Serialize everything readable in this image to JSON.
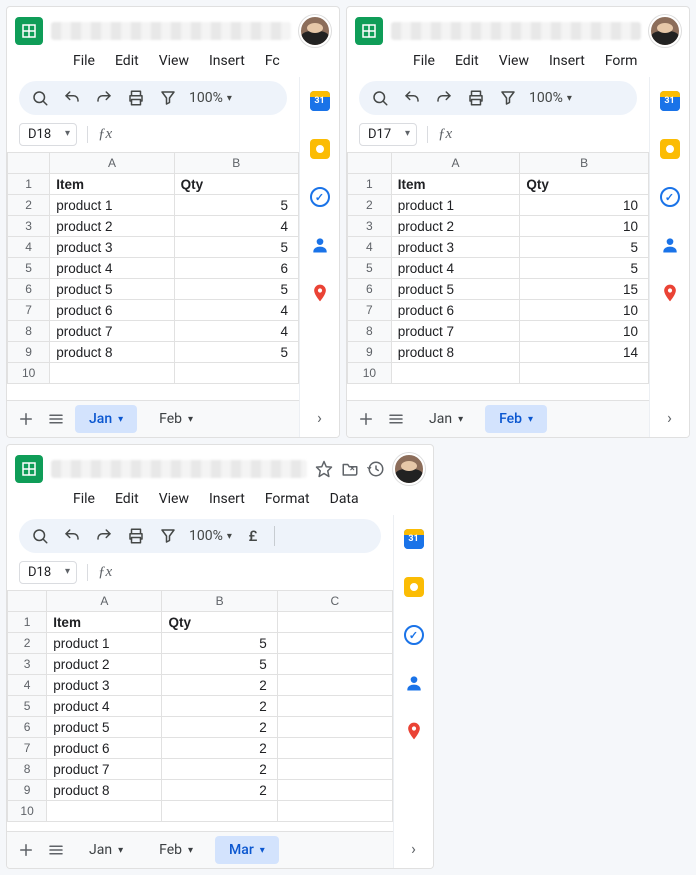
{
  "menu": {
    "file": "File",
    "edit": "Edit",
    "view": "View",
    "insert": "Insert",
    "format_short": "Fc",
    "format_mid": "Form",
    "format": "Format",
    "data": "Data"
  },
  "zoom": "100%",
  "currency_symbol": "£",
  "headers": {
    "item": "Item",
    "qty": "Qty"
  },
  "colA": "A",
  "colB": "B",
  "colC": "C",
  "tabs": {
    "jan": "Jan",
    "feb": "Feb",
    "mar": "Mar"
  },
  "panes": [
    {
      "namebox": "D18",
      "active_tab": "jan",
      "tabs_visible": [
        "jan",
        "feb"
      ],
      "show_col_c": false,
      "format_label": "format_short",
      "show_currency": false,
      "chart_data": {
        "type": "table",
        "categories": [
          "product 1",
          "product 2",
          "product 3",
          "product 4",
          "product 5",
          "product 6",
          "product 7",
          "product 8"
        ],
        "values": [
          5,
          4,
          5,
          6,
          5,
          4,
          4,
          5
        ]
      }
    },
    {
      "namebox": "D17",
      "active_tab": "feb",
      "tabs_visible": [
        "jan",
        "feb"
      ],
      "show_col_c": false,
      "format_label": "format_mid",
      "show_currency": false,
      "chart_data": {
        "type": "table",
        "categories": [
          "product 1",
          "product 2",
          "product 3",
          "product 4",
          "product 5",
          "product 6",
          "product 7",
          "product 8"
        ],
        "values": [
          10,
          10,
          5,
          5,
          15,
          10,
          10,
          14
        ]
      }
    },
    {
      "namebox": "D18",
      "active_tab": "mar",
      "tabs_visible": [
        "jan",
        "feb",
        "mar"
      ],
      "show_col_c": true,
      "format_label": "format",
      "show_data_menu": true,
      "show_currency": true,
      "show_title_icons": true,
      "chart_data": {
        "type": "table",
        "categories": [
          "product 1",
          "product 2",
          "product 3",
          "product 4",
          "product 5",
          "product 6",
          "product 7",
          "product 8"
        ],
        "values": [
          5,
          5,
          2,
          2,
          2,
          2,
          2,
          2
        ]
      }
    }
  ]
}
